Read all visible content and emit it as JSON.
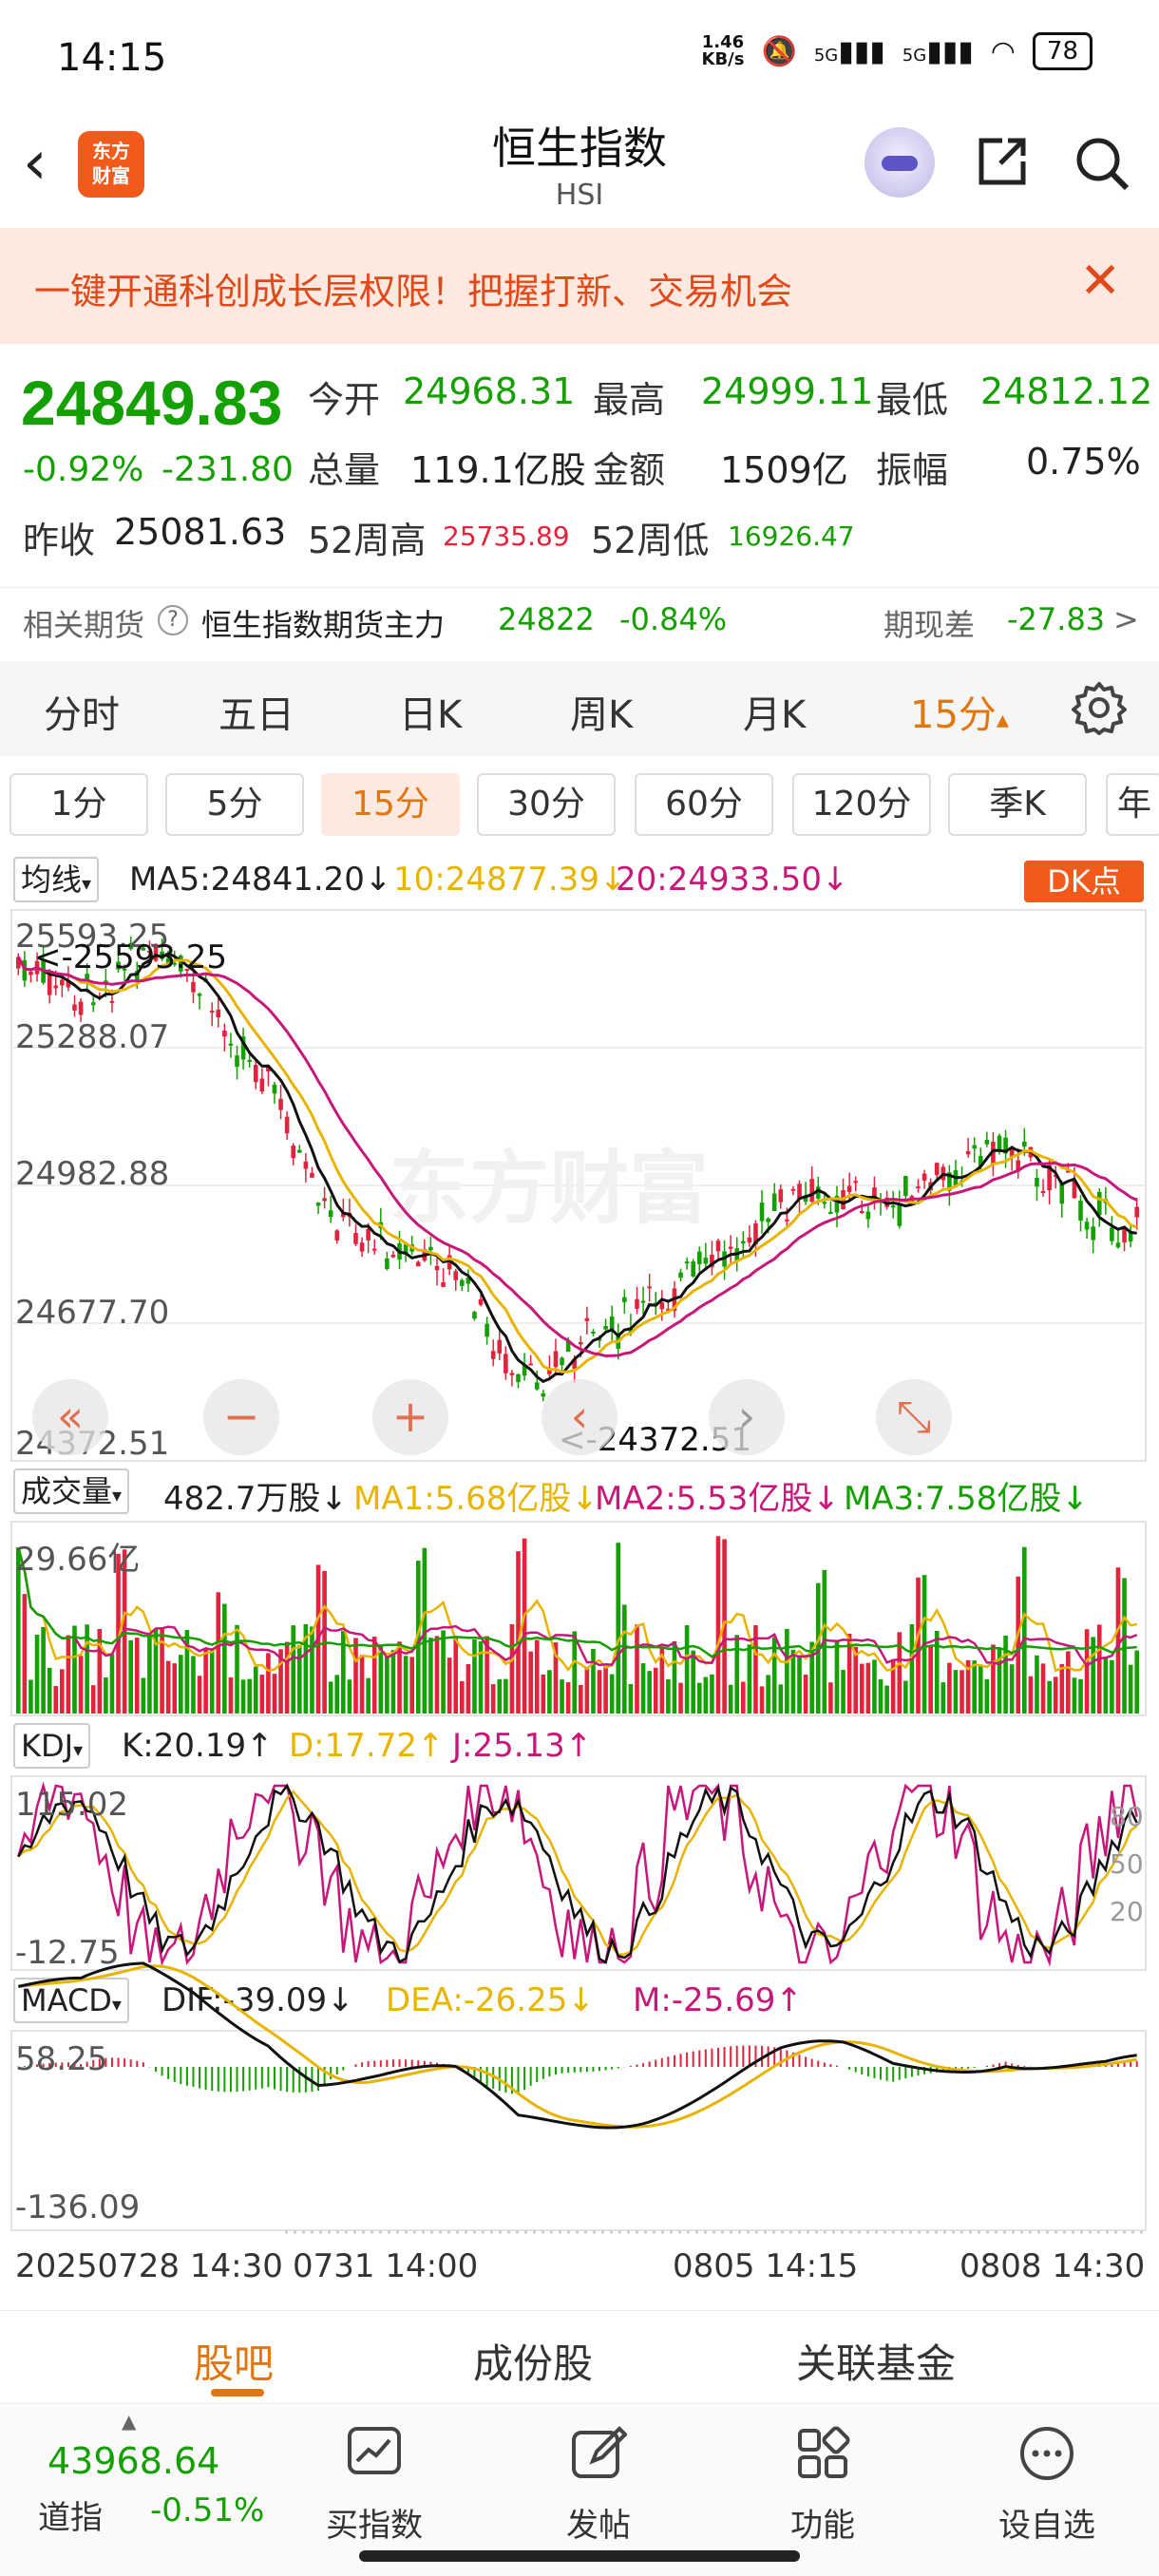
{
  "status_bar": {
    "time": "14:15",
    "net_speed_value": "1.46",
    "net_speed_unit": "KB/s",
    "signal_1": "5G",
    "signal_2": "5G",
    "battery": "78"
  },
  "header": {
    "logo_line1": "东方",
    "logo_line2": "财富",
    "title": "恒生指数",
    "subtitle": "HSI"
  },
  "banner": {
    "text": "一键开通科创成长层权限！把握打新、交易机会",
    "close": "✕"
  },
  "quote": {
    "price": "24849.83",
    "change_pct": "-0.92%",
    "change_abs": "-231.80",
    "open_label": "今开",
    "open": "24968.31",
    "high_label": "最高",
    "high": "24999.11",
    "low_label": "最低",
    "low": "24812.12",
    "volume_label": "总量",
    "volume": "119.1亿股",
    "amount_label": "金额",
    "amount": "1509亿",
    "amplitude_label": "振幅",
    "amplitude": "0.75%",
    "prev_close_label": "昨收",
    "prev_close": "25081.63",
    "week52_high_label": "52周高",
    "week52_high": "25735.89",
    "week52_low_label": "52周低",
    "week52_low": "16926.47"
  },
  "futures": {
    "label": "相关期货",
    "name": "恒生指数期货主力",
    "price": "24822",
    "change": "-0.84%",
    "basis_label": "期现差",
    "basis": "-27.83",
    "arrow": ">"
  },
  "period_tabs": [
    "分时",
    "五日",
    "日K",
    "周K",
    "月K",
    "15分"
  ],
  "active_period_arrow": "▴",
  "minute_chips": [
    "1分",
    "5分",
    "15分",
    "30分",
    "60分",
    "120分",
    "季K",
    "年"
  ],
  "kline": {
    "selector": "均线",
    "ma5": "MA5:24841.20↓",
    "ma10": "10:24877.39↓",
    "ma20": "20:24933.50↓",
    "dk_button": "DK点",
    "y_labels": [
      "25593.25",
      "25288.07",
      "24982.88",
      "24677.70",
      "24372.51"
    ],
    "high_marker": "<-25593.25",
    "low_marker": "<-24372.51",
    "watermark": "东方财富",
    "ma5_color": "#111111",
    "ma10_color": "#e8b400",
    "ma20_color": "#c8177a"
  },
  "volume": {
    "selector": "成交量",
    "current": "482.7万股↓",
    "ma1": "MA1:5.68亿股↓",
    "ma2": "MA2:5.53亿股↓",
    "ma3": "MA3:7.58亿股↓",
    "max_label": "29.66亿"
  },
  "kdj": {
    "selector": "KDJ",
    "k": "K:20.19↑",
    "d": "D:17.72↑",
    "j": "J:25.13↑",
    "max_label": "115.02",
    "min_label": "-12.75",
    "level_80": "80",
    "level_50": "50",
    "level_20": "20"
  },
  "macd": {
    "selector": "MACD",
    "dif": "DIF:-39.09↓",
    "dea": "DEA:-26.25↓",
    "m": "M:-25.69↑",
    "max_label": "58.25",
    "min_label": "-136.09"
  },
  "x_axis": [
    "20250728 14:30",
    "0731 14:00",
    "0805 14:15",
    "0808 14:30"
  ],
  "bottom_tabs": [
    "股吧",
    "成份股",
    "关联基金"
  ],
  "toolbar": {
    "djia_value": "43968.64",
    "djia_label": "道指",
    "djia_change": "-0.51%",
    "tools": [
      "买指数",
      "发帖",
      "功能",
      "设自选"
    ]
  }
}
